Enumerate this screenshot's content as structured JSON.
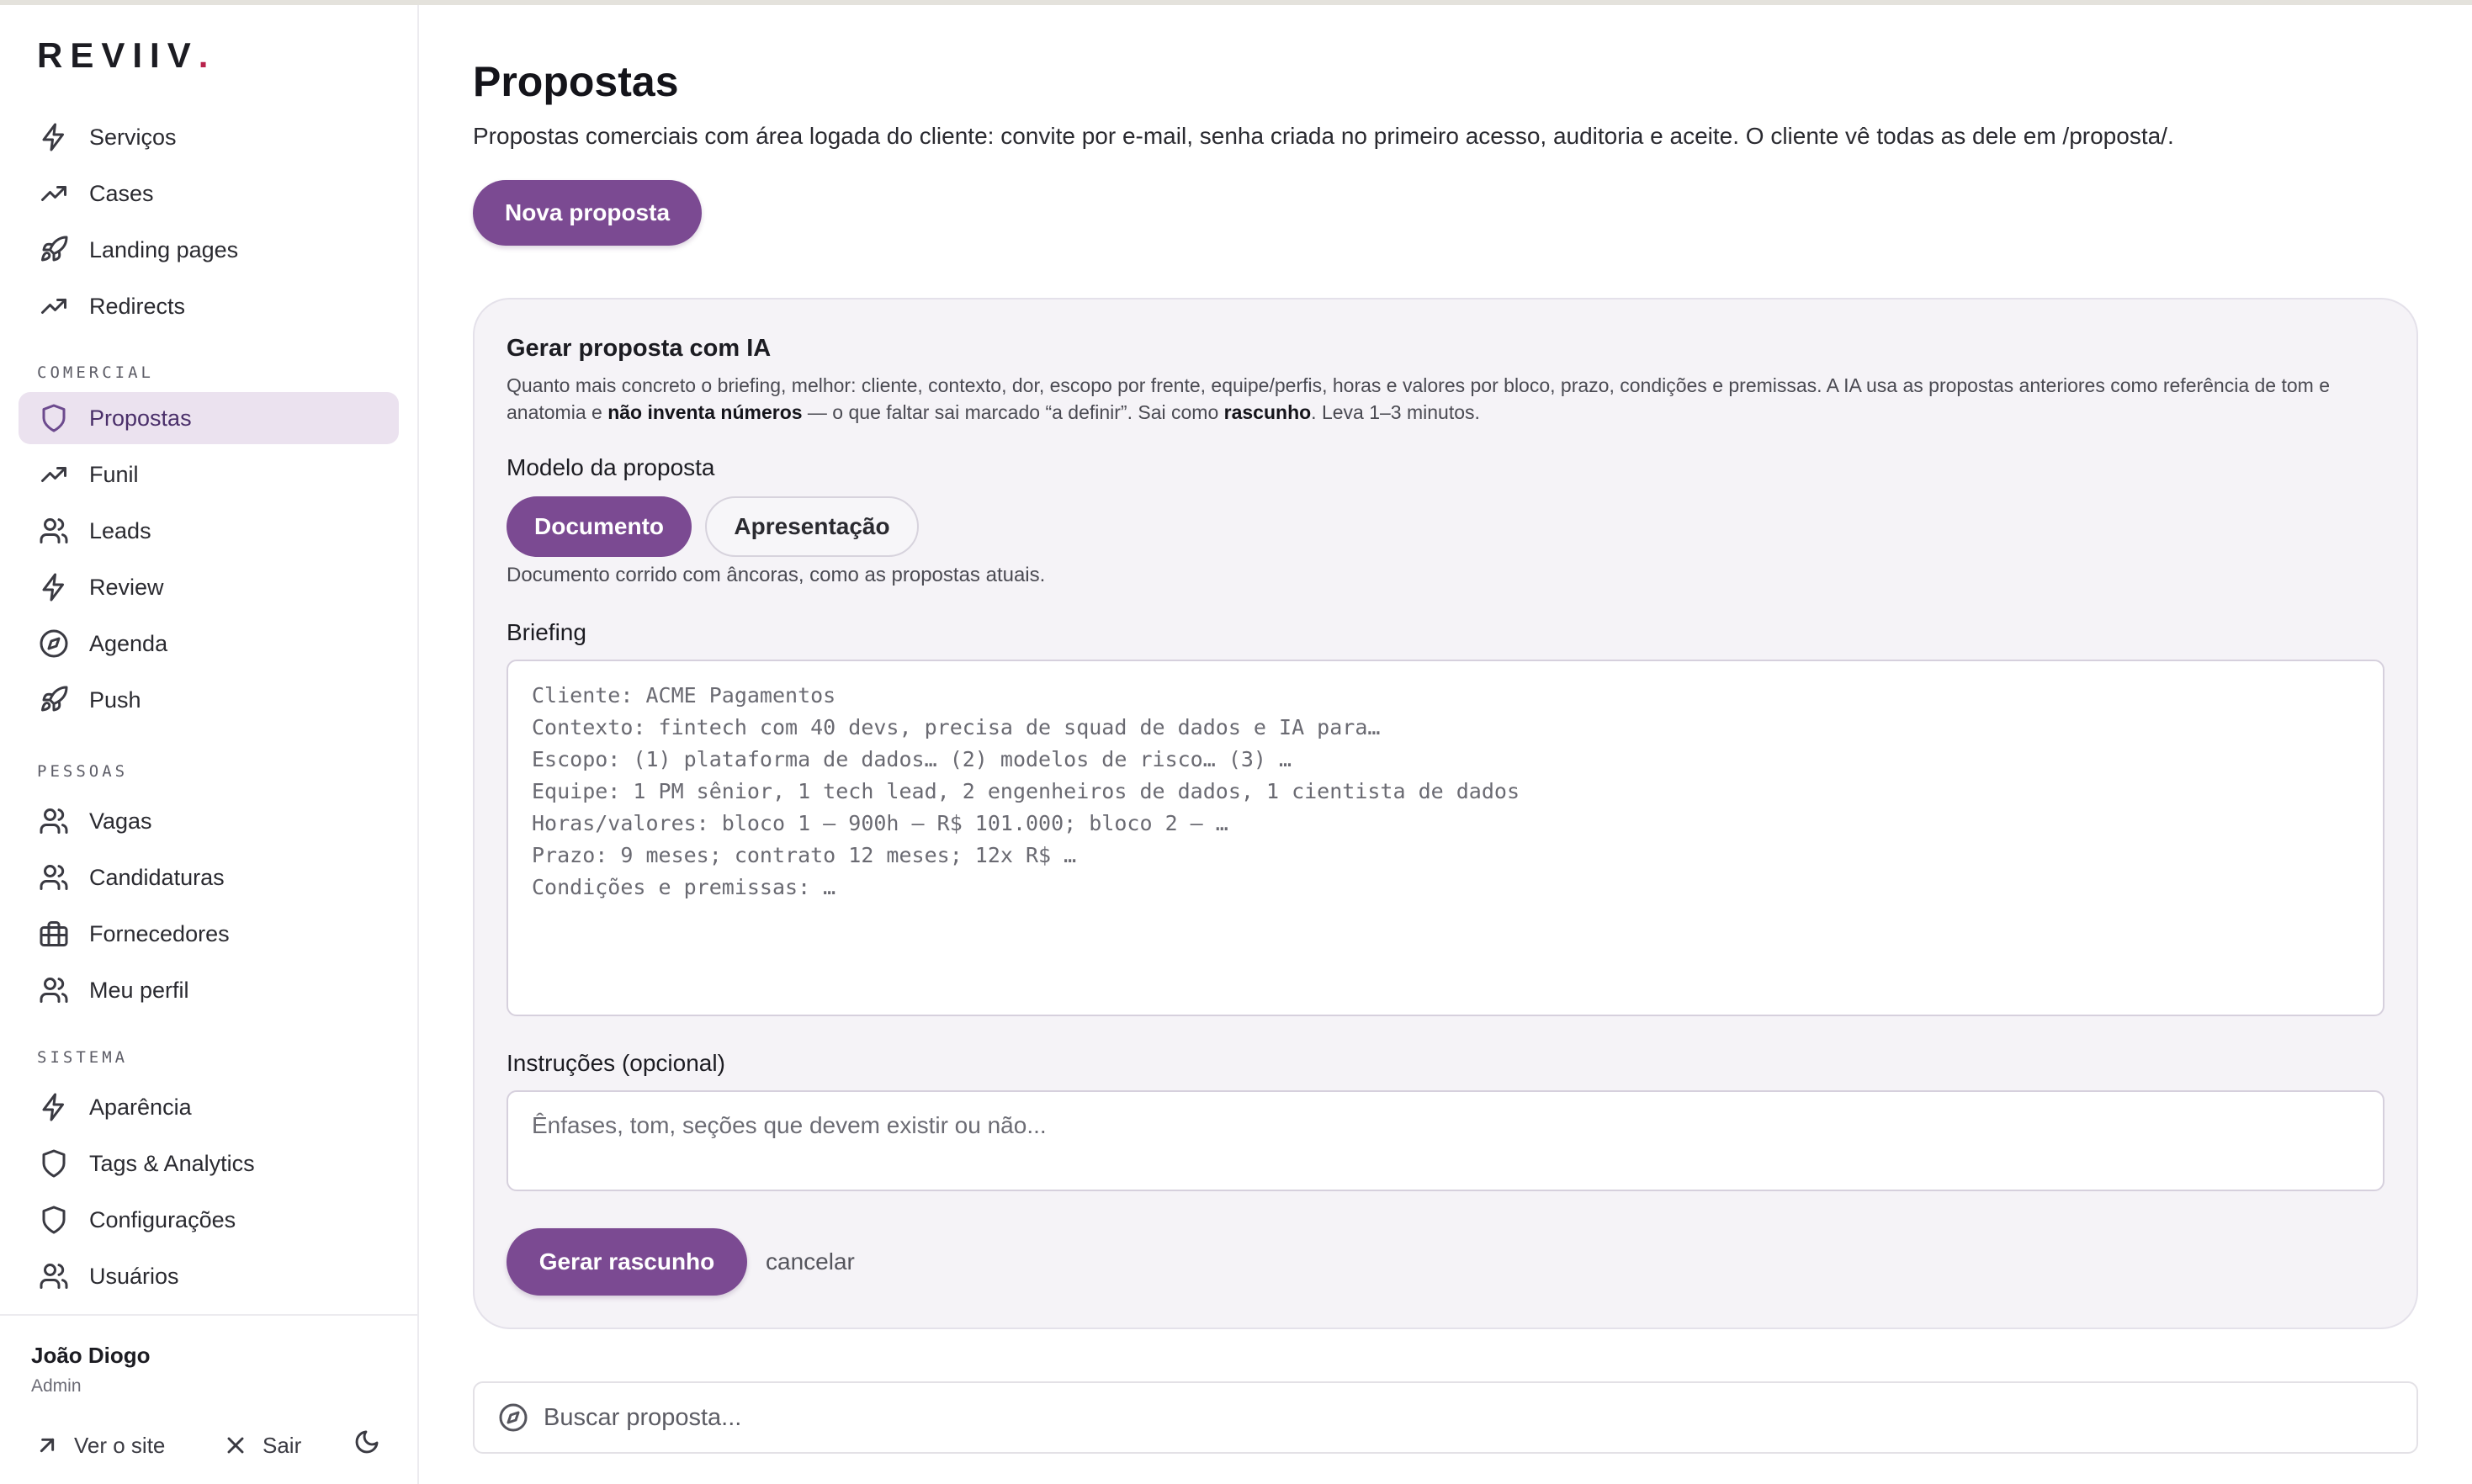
{
  "brand": {
    "name": "REVIIV",
    "dot": "."
  },
  "sidebar": {
    "top_items": [
      {
        "label": "Serviços",
        "icon": "lightning-icon"
      },
      {
        "label": "Cases",
        "icon": "trend-icon"
      },
      {
        "label": "Landing pages",
        "icon": "rocket-icon"
      },
      {
        "label": "Redirects",
        "icon": "trend-icon"
      }
    ],
    "sections": [
      {
        "label": "COMERCIAL",
        "items": [
          {
            "label": "Propostas",
            "icon": "shield-icon",
            "active": true
          },
          {
            "label": "Funil",
            "icon": "trend-icon"
          },
          {
            "label": "Leads",
            "icon": "users-icon"
          },
          {
            "label": "Review",
            "icon": "lightning-icon"
          },
          {
            "label": "Agenda",
            "icon": "compass-icon"
          },
          {
            "label": "Push",
            "icon": "rocket-icon"
          }
        ]
      },
      {
        "label": "PESSOAS",
        "items": [
          {
            "label": "Vagas",
            "icon": "users-icon"
          },
          {
            "label": "Candidaturas",
            "icon": "users-icon"
          },
          {
            "label": "Fornecedores",
            "icon": "briefcase-icon"
          },
          {
            "label": "Meu perfil",
            "icon": "users-icon"
          }
        ]
      },
      {
        "label": "SISTEMA",
        "items": [
          {
            "label": "Aparência",
            "icon": "lightning-icon"
          },
          {
            "label": "Tags & Analytics",
            "icon": "shield-icon"
          },
          {
            "label": "Configurações",
            "icon": "shield-icon"
          },
          {
            "label": "Usuários",
            "icon": "users-icon"
          }
        ]
      }
    ],
    "user": {
      "name": "João Diogo",
      "role": "Admin"
    },
    "footer": {
      "site_label": "Ver o site",
      "logout_label": "Sair",
      "theme_icon": "moon-icon"
    }
  },
  "main": {
    "title": "Propostas",
    "description": "Propostas comerciais com área logada do cliente: convite por e-mail, senha criada no primeiro acesso, auditoria e aceite. O cliente vê todas as dele em /proposta/.",
    "new_button": "Nova proposta",
    "ai_card": {
      "title": "Gerar proposta com IA",
      "desc_part1": "Quanto mais concreto o briefing, melhor: cliente, contexto, dor, escopo por frente, equipe/perfis, horas e valores por bloco, prazo, condições e premissas. A IA usa as propostas anteriores como referência de tom e anatomia e ",
      "desc_bold1": "não inventa números",
      "desc_part2": " — o que faltar sai marcado “a definir”. Sai como ",
      "desc_bold2": "rascunho",
      "desc_part3": ". Leva 1–3 minutos.",
      "model_label": "Modelo da proposta",
      "model_options": [
        "Documento",
        "Apresentação"
      ],
      "model_selected": "Documento",
      "model_helper": "Documento corrido com âncoras, como as propostas atuais.",
      "briefing_label": "Briefing",
      "briefing_placeholder": "Cliente: ACME Pagamentos\nContexto: fintech com 40 devs, precisa de squad de dados e IA para…\nEscopo: (1) plataforma de dados… (2) modelos de risco… (3) …\nEquipe: 1 PM sênior, 1 tech lead, 2 engenheiros de dados, 1 cientista de dados\nHoras/valores: bloco 1 — 900h — R$ 101.000; bloco 2 — …\nPrazo: 9 meses; contrato 12 meses; 12x R$ …\nCondições e premissas: …",
      "instructions_label": "Instruções (opcional)",
      "instructions_placeholder": "Ênfases, tom, seções que devem existir ou não...",
      "generate_button": "Gerar rascunho",
      "cancel_label": "cancelar"
    },
    "search_placeholder": "Buscar proposta..."
  }
}
